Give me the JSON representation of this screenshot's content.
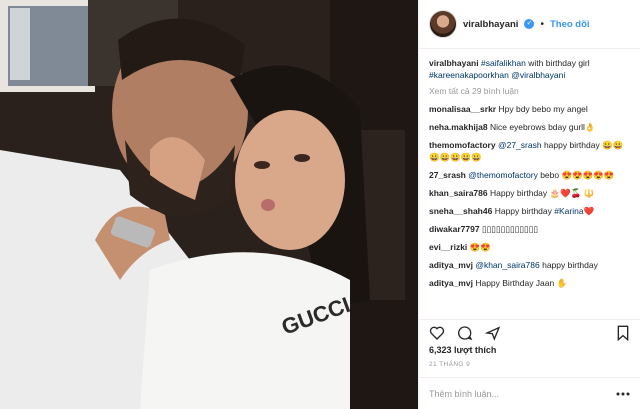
{
  "header": {
    "username": "viralbhayani",
    "separator": "•",
    "follow_label": "Theo dõi"
  },
  "caption": {
    "username": "viralbhayani",
    "parts": [
      "#saifalikhan",
      " with birthday girl ",
      "#kareenakapoorkhan",
      " ",
      "@viralbhayani"
    ]
  },
  "view_all_label": "Xem tất cả 29 bình luận",
  "comments": [
    {
      "user": "monalisaa__srkr",
      "text": "Hpy bdy bebo my angel"
    },
    {
      "user": "neha.makhija8",
      "text": "Nice eyebrows bday gurll👌"
    },
    {
      "user": "themomofactory",
      "mention": "@27_srash",
      "text": " happy birthday 😀😀😀😀😀😀😀"
    },
    {
      "user": "27_srash",
      "mention": "@themomofactory",
      "text": " bebo 😍😍😍😍😍"
    },
    {
      "user": "khan_saira786",
      "text": "Happy birthday 🎂❤️🍒 🔱"
    },
    {
      "user": "sneha__shah46",
      "text": "Happy birthday ",
      "tag": "#Karina",
      "after": "❤️"
    },
    {
      "user": "diwakar7797",
      "text": "▯▯▯▯▯▯▯▯▯▯▯▯"
    },
    {
      "user": "evi__rizki",
      "text": "😍😍"
    },
    {
      "user": "aditya_mvj",
      "mention": "@khan_saira786",
      "text": " happy birthday"
    },
    {
      "user": "aditya_mvj",
      "text": "Happy Birthday Jaan ✋"
    }
  ],
  "icons": [
    "heart-icon",
    "comment-icon",
    "share-icon",
    "bookmark-icon",
    "more-icon"
  ],
  "likes_label": "6,323 lượt thích",
  "date_label": "21 THÁNG 9",
  "add_comment_placeholder": "Thêm bình luận...",
  "colors": {
    "link": "#003569",
    "follow": "#3897f0",
    "muted": "#999999"
  }
}
